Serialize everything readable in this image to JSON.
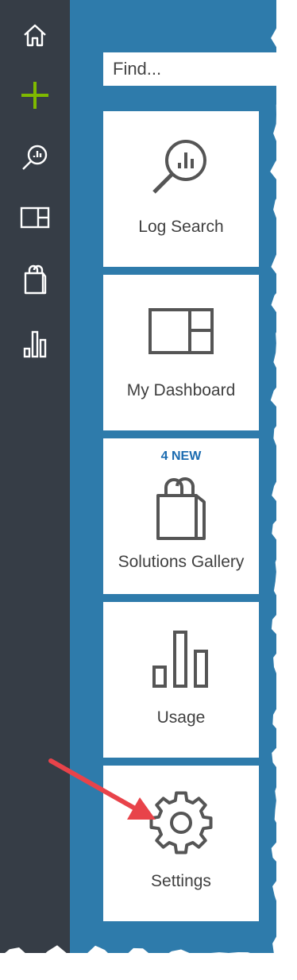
{
  "sidebar": {
    "icons": [
      {
        "name": "home-icon"
      },
      {
        "name": "add-icon",
        "color": "#7fba00"
      },
      {
        "name": "search-icon"
      },
      {
        "name": "dashboard-icon"
      },
      {
        "name": "shopping-bag-icon"
      },
      {
        "name": "bar-chart-icon"
      }
    ]
  },
  "search": {
    "placeholder": "Find..."
  },
  "tiles": [
    {
      "label": "Log Search",
      "icon": "search-chart-icon"
    },
    {
      "label": "My Dashboard",
      "icon": "dashboard-icon"
    },
    {
      "label": "Solutions Gallery",
      "icon": "shopping-bag-icon",
      "badge": "4 NEW"
    },
    {
      "label": "Usage",
      "icon": "bar-chart-icon"
    },
    {
      "label": "Settings",
      "icon": "gear-icon"
    }
  ],
  "colors": {
    "rail": "#363d46",
    "main": "#2e7bab",
    "accent_add": "#7fba00",
    "badge": "#1b6bb0",
    "arrow": "#e8434a"
  }
}
